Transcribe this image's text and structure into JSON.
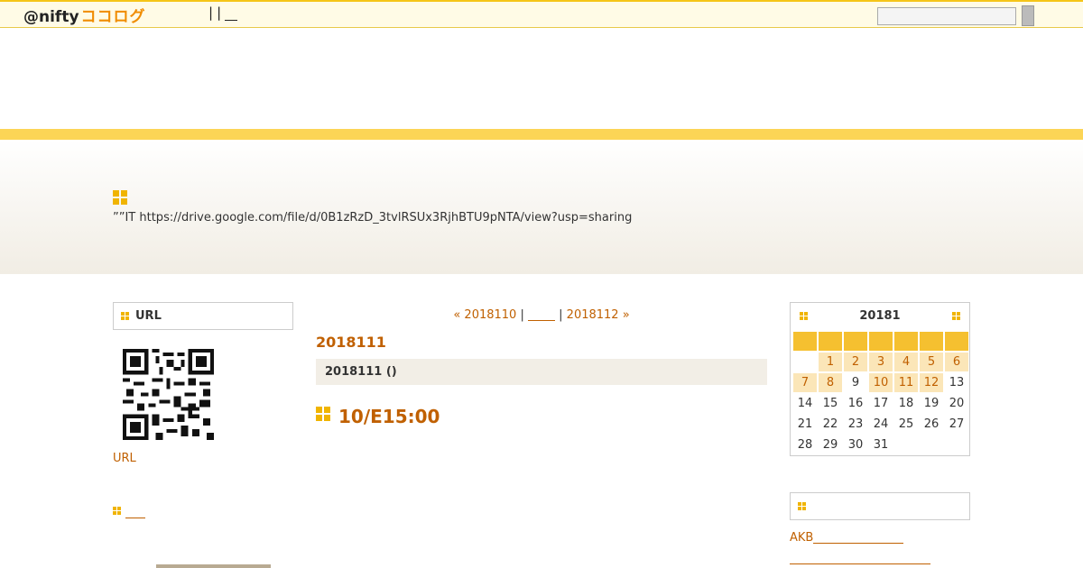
{
  "topbar": {
    "logo_at": "@nifty",
    "logo_kana": "ココログ",
    "nav_sep1": "|",
    "nav_sep2": "|",
    "search_placeholder": ""
  },
  "banner": {
    "description": "””IT  https://drive.google.com/file/d/0B1zRzD_3tvlRSUx3RjhBTU9pNTA/view?usp=sharing"
  },
  "left": {
    "url_box_title": "URL",
    "url_link": "URL"
  },
  "center": {
    "prev_link": "« 2018110",
    "sep1": "|",
    "sep2": "|",
    "next_link": "2018112 »",
    "date_title": "2018111",
    "entry_bar": "2018111 ()",
    "entry_title": "10/E15:00"
  },
  "calendar": {
    "title": "20181",
    "days": [
      {
        "d": "",
        "link": false
      },
      {
        "d": "1",
        "link": true
      },
      {
        "d": "2",
        "link": true
      },
      {
        "d": "3",
        "link": true
      },
      {
        "d": "4",
        "link": true
      },
      {
        "d": "5",
        "link": true
      },
      {
        "d": "6",
        "link": true
      },
      {
        "d": "7",
        "link": true
      },
      {
        "d": "8",
        "link": true
      },
      {
        "d": "9",
        "link": false
      },
      {
        "d": "10",
        "link": true
      },
      {
        "d": "11",
        "link": true
      },
      {
        "d": "12",
        "link": true
      },
      {
        "d": "13",
        "link": false
      },
      {
        "d": "14",
        "link": false
      },
      {
        "d": "15",
        "link": false
      },
      {
        "d": "16",
        "link": false
      },
      {
        "d": "17",
        "link": false
      },
      {
        "d": "18",
        "link": false
      },
      {
        "d": "19",
        "link": false
      },
      {
        "d": "20",
        "link": false
      },
      {
        "d": "21",
        "link": false
      },
      {
        "d": "22",
        "link": false
      },
      {
        "d": "23",
        "link": false
      },
      {
        "d": "24",
        "link": false
      },
      {
        "d": "25",
        "link": false
      },
      {
        "d": "26",
        "link": false
      },
      {
        "d": "27",
        "link": false
      },
      {
        "d": "28",
        "link": false
      },
      {
        "d": "29",
        "link": false
      },
      {
        "d": "30",
        "link": false
      },
      {
        "d": "31",
        "link": false
      }
    ]
  },
  "right": {
    "link1": "AKB"
  },
  "colors": {
    "accent": "#f0b400",
    "link": "#c06000",
    "band": "#fcd556"
  }
}
